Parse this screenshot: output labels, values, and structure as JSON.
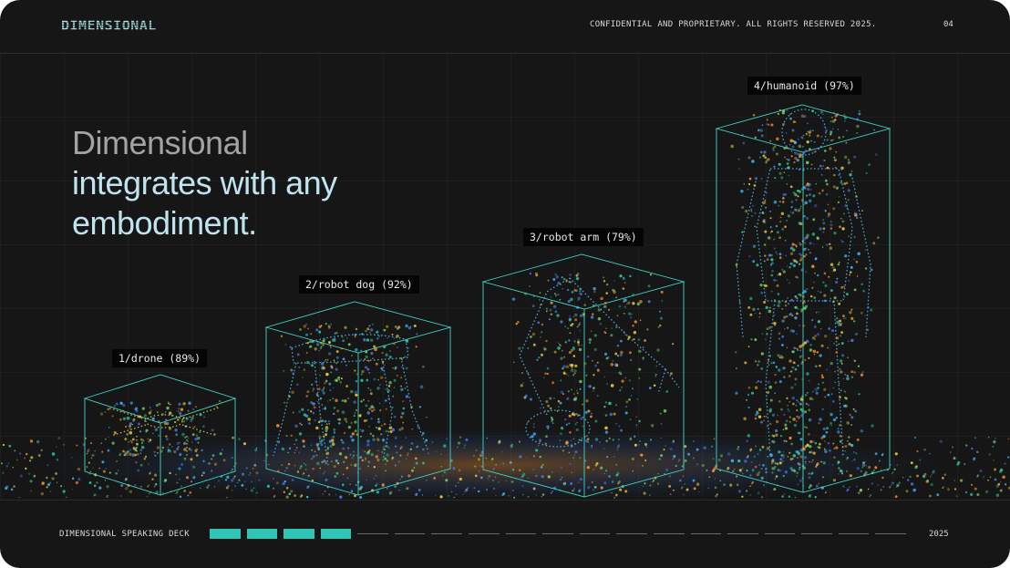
{
  "header": {
    "logo": "DIMENSIONAL",
    "confidential": "CONFIDENTIAL AND PROPRIETARY. ALL RIGHTS RESERVED 2025.",
    "page_number": "04"
  },
  "headline": {
    "line1": "Dimensional",
    "line2": "integrates with any",
    "line3": "embodiment."
  },
  "embodiments": [
    {
      "label": "1/drone (89%)",
      "icon": "drone-pointcloud"
    },
    {
      "label": "2/robot dog (92%)",
      "icon": "robot-dog-pointcloud"
    },
    {
      "label": "3/robot arm (79%)",
      "icon": "robot-arm-pointcloud"
    },
    {
      "label": "4/humanoid (97%)",
      "icon": "humanoid-pointcloud"
    }
  ],
  "footer": {
    "title": "DIMENSIONAL SPEAKING DECK",
    "year": "2025",
    "progress": {
      "current": 4,
      "total": 19
    }
  },
  "colors": {
    "background": "#161616",
    "accent": "#2ec4b6",
    "box_edge": "#3fd6c8",
    "headline_muted": "#a3a3a3",
    "headline_accent": "#bfe4f0"
  }
}
